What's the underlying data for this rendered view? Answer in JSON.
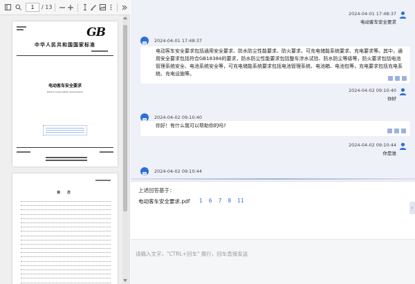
{
  "pdf": {
    "current_page": "1",
    "total_pages": "/ 13",
    "toolbar_icons": [
      "sidebar-icon",
      "search-icon",
      "zoom-out-icon",
      "zoom-in-icon",
      "text-cursor-icon",
      "draw-icon",
      "image-icon",
      "more-icon",
      "collapse-icon"
    ],
    "page1": {
      "gb_logo": "GB",
      "standard_title": "中华人民共和国国家标准",
      "doc_title": "电动客车安全要求",
      "doc_title_en": "Electric buses safety requirements"
    },
    "page2": {
      "toc_title": "目 次"
    }
  },
  "chat": {
    "messages": [
      {
        "role": "user",
        "time": "2024-04-01 17:48:37",
        "text": "电动客车安全要求"
      },
      {
        "role": "bot",
        "time": "2024-04-01 17:48:37",
        "text": "电动客车安全要求包括通用安全要求、防水防尘性能要求、防火要求、可充电储能系统要求、充电要求等。其中，通用安全要求包括符合GB18384的要求，防水防尘性能要求包括整车涉水试验、防水防尘等级等，防火要求包括电池管理系统安全、电池系统安全等，可充电储能系统要求包括电池管理系统、电池箱、电池包等，充电要求包括充电系统、充电设施等。"
      },
      {
        "role": "user",
        "time": "2024-04-02 09:10:40",
        "text": "你好"
      },
      {
        "role": "bot",
        "time": "2024-04-02 09:10:40",
        "text": "你好！有什么我可以帮助你的吗?"
      },
      {
        "role": "user",
        "time": "2024-04-02 09:10:44",
        "text": "你是谁"
      },
      {
        "role": "bot",
        "time": "2024-04-02 09:10:44",
        "text": ""
      }
    ],
    "references": {
      "label": "上述回答基于：",
      "file": "电动客车安全要求.pdf",
      "pages": [
        "1",
        "6",
        "7",
        "8",
        "11"
      ]
    },
    "input": {
      "placeholder": "请输入文字，\"CTRL+回车\" 换行，回车直接发送"
    }
  },
  "colors": {
    "accent": "#2f6ed8",
    "chat_bg": "#eef1f8",
    "action_icon": "#9bb2dd"
  }
}
